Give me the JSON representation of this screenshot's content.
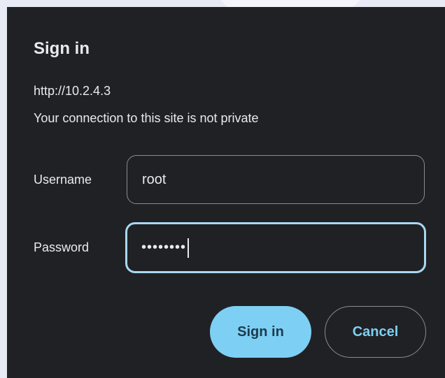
{
  "dialog": {
    "title": "Sign in",
    "origin": "http://10.2.4.3",
    "warning": "Your connection to this site is not private"
  },
  "form": {
    "username_label": "Username",
    "username_value": "root",
    "password_label": "Password",
    "password_masked": "••••••••"
  },
  "buttons": {
    "sign_in_label": "Sign in",
    "cancel_label": "Cancel"
  },
  "colors": {
    "dialog_background": "#202124",
    "accent": "#7ecff4",
    "focus_border": "#a8d8f2",
    "page_background": "#e8ebf5"
  }
}
